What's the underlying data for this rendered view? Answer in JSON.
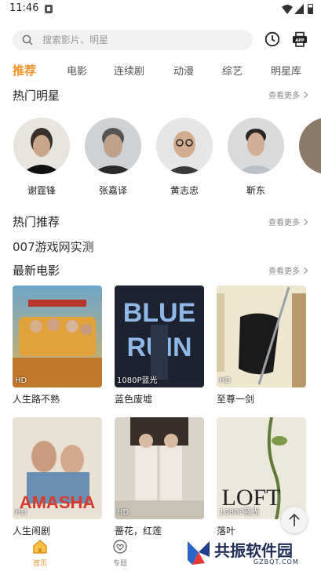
{
  "status_bar": {
    "time": "11:46"
  },
  "search": {
    "placeholder": "搜索影片、明星"
  },
  "icons": {
    "history": "clock-icon",
    "app": "app-download-icon"
  },
  "accent_color": "#f0932b",
  "tabs": [
    {
      "label": "推荐",
      "active": true
    },
    {
      "label": "电影"
    },
    {
      "label": "连续剧"
    },
    {
      "label": "动漫"
    },
    {
      "label": "综艺"
    },
    {
      "label": "明星库"
    }
  ],
  "hot_stars": {
    "title": "热门明星",
    "more": "查看更多",
    "items": [
      {
        "name": "谢霆锋"
      },
      {
        "name": "张嘉译"
      },
      {
        "name": "黄志忠"
      },
      {
        "name": "靳东"
      }
    ]
  },
  "hot_recommend": {
    "title": "热门推荐",
    "more": "查看更多"
  },
  "game_line": "007游戏网实测",
  "latest_movies": {
    "title": "最新电影",
    "more": "查看更多",
    "items": [
      {
        "title": "人生路不熟",
        "badge": "HD"
      },
      {
        "title": "蓝色废墟",
        "badge": "1080P蓝光",
        "poster_text": "BLUE RUIN"
      },
      {
        "title": "至尊一剑",
        "badge": "HD"
      },
      {
        "title": "人生闹剧",
        "badge": "HD",
        "poster_text": "AMASHA"
      },
      {
        "title": "蔷花，红莲",
        "badge": "HD"
      },
      {
        "title": "落叶",
        "badge": "1080P蓝光",
        "poster_text": "LOFT"
      }
    ]
  },
  "bottom_nav": [
    {
      "label": "首页",
      "active": true
    },
    {
      "label": "专题"
    }
  ],
  "watermark": {
    "text": "共振软件园",
    "url": "GZBQT.COM"
  }
}
